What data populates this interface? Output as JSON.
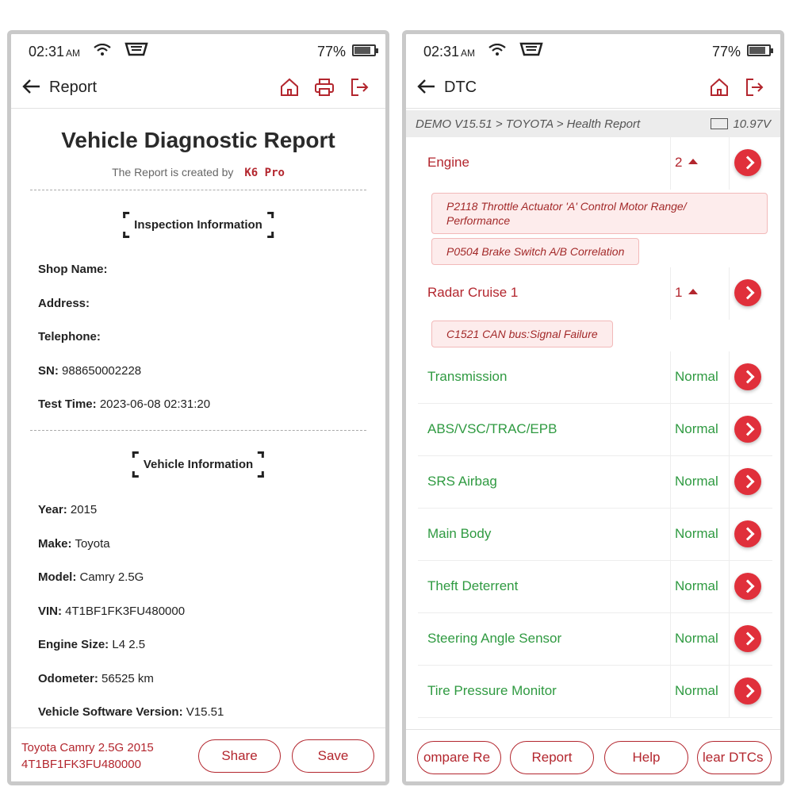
{
  "status": {
    "time": "02:31",
    "ampm": "AM",
    "battery_pct": "77%",
    "battery_level": 0.77
  },
  "left": {
    "title": "Report",
    "report_title": "Vehicle Diagnostic Report",
    "created_by_label": "The Report is created by",
    "created_by_value": "K6 Pro",
    "inspection_header": "Inspection Information",
    "shop_label": "Shop Name:",
    "address_label": "Address:",
    "telephone_label": "Telephone:",
    "sn_label": "SN:",
    "sn_value": "988650002228",
    "testtime_label": "Test Time:",
    "testtime_value": "2023-06-08 02:31:20",
    "vehicle_header": "Vehicle Information",
    "year_label": "Year:",
    "year_value": "2015",
    "make_label": "Make:",
    "make_value": "Toyota",
    "model_label": "Model:",
    "model_value": "Camry 2.5G",
    "vin_label": "VIN:",
    "vin_value": "4T1BF1FK3FU480000",
    "engine_label": "Engine Size:",
    "engine_value": "L4 2.5",
    "odo_label": "Odometer:",
    "odo_value": "56525 km",
    "software_label": "Vehicle Software Version:",
    "software_value": "V15.51",
    "footer_car": "Toyota Camry 2.5G 2015",
    "footer_vin": "4T1BF1FK3FU480000",
    "share_label": "Share",
    "save_label": "Save"
  },
  "right": {
    "title": "DTC",
    "breadcrumb": "DEMO V15.51 > TOYOTA > Health Report",
    "voltage": "10.97V",
    "engine": {
      "name": "Engine",
      "count": "2"
    },
    "engine_dtcs": [
      "P2118 Throttle Actuator 'A' Control Motor Range/ Performance",
      "P0504 Brake Switch A/B Correlation"
    ],
    "radar": {
      "name": "Radar Cruise 1",
      "count": "1"
    },
    "radar_dtcs": [
      "C1521 CAN bus:Signal Failure"
    ],
    "systems": [
      {
        "name": "Transmission",
        "status": "Normal"
      },
      {
        "name": "ABS/VSC/TRAC/EPB",
        "status": "Normal"
      },
      {
        "name": "SRS Airbag",
        "status": "Normal"
      },
      {
        "name": "Main Body",
        "status": "Normal"
      },
      {
        "name": "Theft Deterrent",
        "status": "Normal"
      },
      {
        "name": "Steering Angle Sensor",
        "status": "Normal"
      },
      {
        "name": "Tire Pressure Monitor",
        "status": "Normal"
      }
    ],
    "buttons": [
      "ompare Re",
      "Report",
      "Help",
      "lear DTCs"
    ]
  }
}
